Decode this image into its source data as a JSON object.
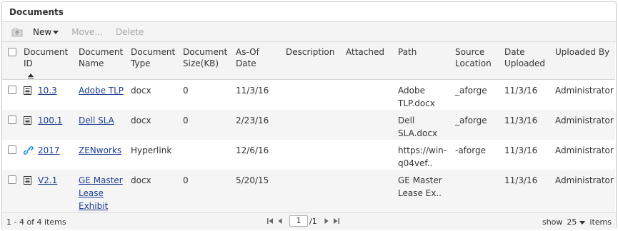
{
  "panel": {
    "title": "Documents"
  },
  "toolbar": {
    "upload_icon": "upload-icon",
    "new_label": "New",
    "move_label": "Move...",
    "delete_label": "Delete"
  },
  "columns": {
    "document_id": "Document ID",
    "document_name": "Document Name",
    "document_type": "Document Type",
    "document_size": "Document Size(KB)",
    "as_of_date": "As-Of Date",
    "description": "Description",
    "attached": "Attached",
    "path": "Path",
    "source_location": "Source Location",
    "date_uploaded": "Date Uploaded",
    "uploaded_by": "Uploaded By"
  },
  "rows": [
    {
      "icon": "document-icon",
      "id": "10.3",
      "name": "Adobe TLP",
      "type": "docx",
      "size": "0",
      "as_of": "11/3/16",
      "description": "",
      "attached": "",
      "path": "Adobe TLP.docx",
      "source": "_aforge",
      "uploaded": "11/3/16",
      "by": "Administrator"
    },
    {
      "icon": "document-icon",
      "id": "100.1",
      "name": "Dell SLA",
      "type": "docx",
      "size": "0",
      "as_of": "2/23/16",
      "description": "",
      "attached": "",
      "path": "Dell SLA.docx",
      "source": "_aforge",
      "uploaded": "11/3/16",
      "by": "Administrator"
    },
    {
      "icon": "hyperlink-icon",
      "id": "2017",
      "name": "ZENworks",
      "type": "Hyperlink",
      "size": "",
      "as_of": "12/6/16",
      "description": "",
      "attached": "",
      "path": "https://win-q04vef..",
      "source": "-aforge",
      "uploaded": "11/3/16",
      "by": "Administrator"
    },
    {
      "icon": "document-icon",
      "id": "V2.1",
      "name": "GE Master Lease Exhibit",
      "type": "docx",
      "size": "0",
      "as_of": "5/20/15",
      "description": "",
      "attached": "",
      "path": "GE Master Lease Ex..",
      "source": "",
      "uploaded": "11/3/16",
      "by": "Administrator"
    }
  ],
  "footer": {
    "range": "1 - 4 of 4 items",
    "page": "1",
    "page_total": "/1",
    "show_label": "show",
    "page_size": "25",
    "items_label": "items"
  },
  "colors": {
    "link": "#1a3d8f",
    "toolbar_bg": "#f4f4f4",
    "alt_row": "#f5f5f5",
    "border": "#c8c8c8"
  }
}
